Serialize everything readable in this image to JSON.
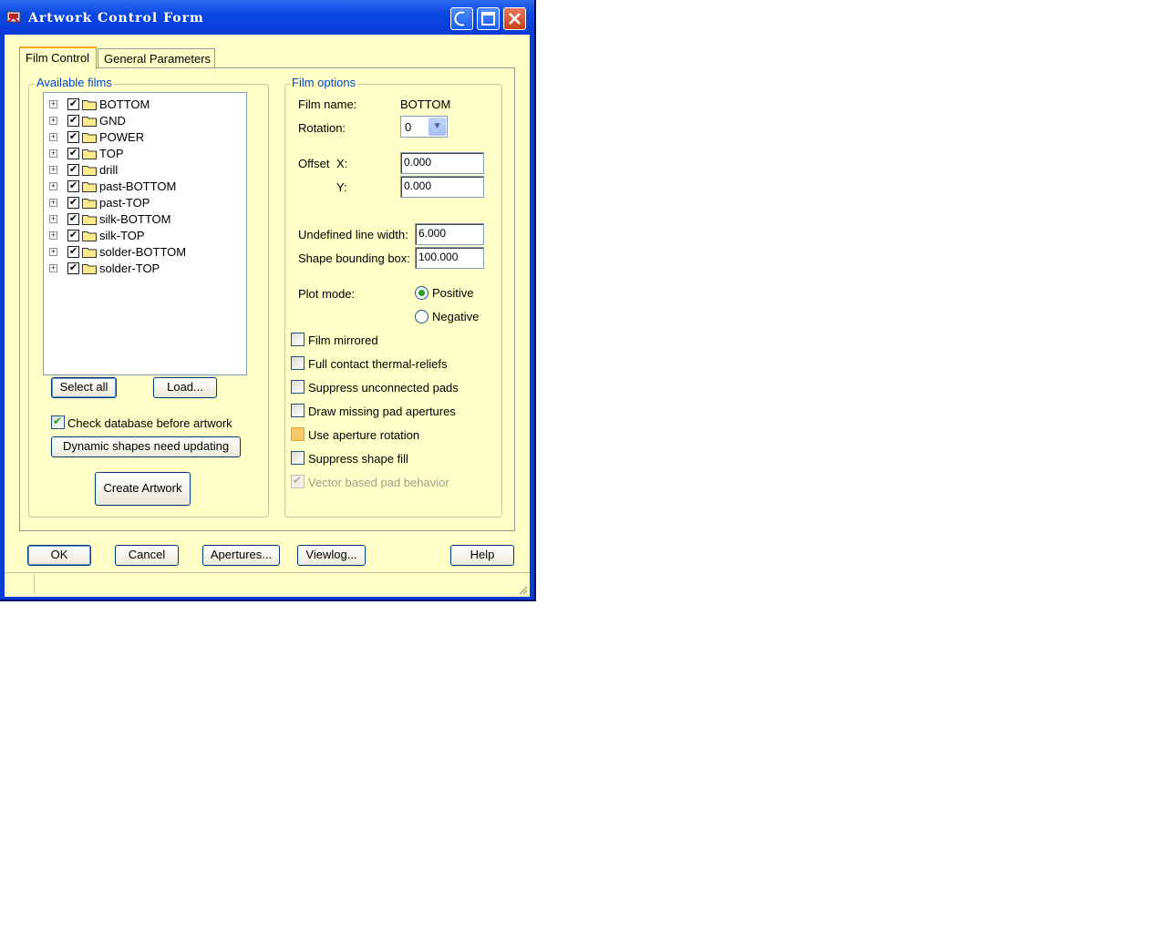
{
  "window": {
    "title": "Artwork Control Form"
  },
  "tabs": [
    "Film Control",
    "General Parameters"
  ],
  "available_films": {
    "legend": "Available films",
    "films": [
      {
        "name": "BOTTOM",
        "checked": true
      },
      {
        "name": "GND",
        "checked": true
      },
      {
        "name": "POWER",
        "checked": true
      },
      {
        "name": "TOP",
        "checked": true
      },
      {
        "name": "drill",
        "checked": true
      },
      {
        "name": "past-BOTTOM",
        "checked": true
      },
      {
        "name": "past-TOP",
        "checked": true
      },
      {
        "name": "silk-BOTTOM",
        "checked": true
      },
      {
        "name": "silk-TOP",
        "checked": true
      },
      {
        "name": "solder-BOTTOM",
        "checked": true
      },
      {
        "name": "solder-TOP",
        "checked": true
      }
    ],
    "select_all": "Select all",
    "load": "Load...",
    "check_database": "Check database before artwork",
    "dynamic_shapes": "Dynamic shapes need updating",
    "create_artwork": "Create Artwork"
  },
  "film_options": {
    "legend": "Film options",
    "film_name_label": "Film name:",
    "film_name_value": "BOTTOM",
    "rotation_label": "Rotation:",
    "rotation_value": "0",
    "offset_label": "Offset",
    "x_label": "X:",
    "x_value": "0.000",
    "y_label": "Y:",
    "y_value": "0.000",
    "undefined_line_width_label": "Undefined line width:",
    "undefined_line_width_value": "6.000",
    "shape_bounding_box_label": "Shape bounding box:",
    "shape_bounding_box_value": "100.000",
    "plot_mode_label": "Plot mode:",
    "positive": "Positive",
    "negative": "Negative",
    "options": [
      {
        "label": "Film mirrored",
        "state": "unchecked"
      },
      {
        "label": "Full contact thermal-reliefs",
        "state": "unchecked"
      },
      {
        "label": "Suppress unconnected pads",
        "state": "unchecked"
      },
      {
        "label": "Draw missing pad apertures",
        "state": "unchecked"
      },
      {
        "label": "Use aperture rotation",
        "state": "hot"
      },
      {
        "label": "Suppress shape fill",
        "state": "unchecked"
      },
      {
        "label": "Vector based pad behavior",
        "state": "disabled"
      }
    ]
  },
  "footer": {
    "ok": "OK",
    "cancel": "Cancel",
    "apertures": "Apertures...",
    "viewlog": "Viewlog...",
    "help": "Help"
  },
  "colors": {
    "title_bar": "#0a3ad8",
    "client_bg": "#ffffc8",
    "legend_text": "#0046d5",
    "check_green": "#21a121"
  }
}
